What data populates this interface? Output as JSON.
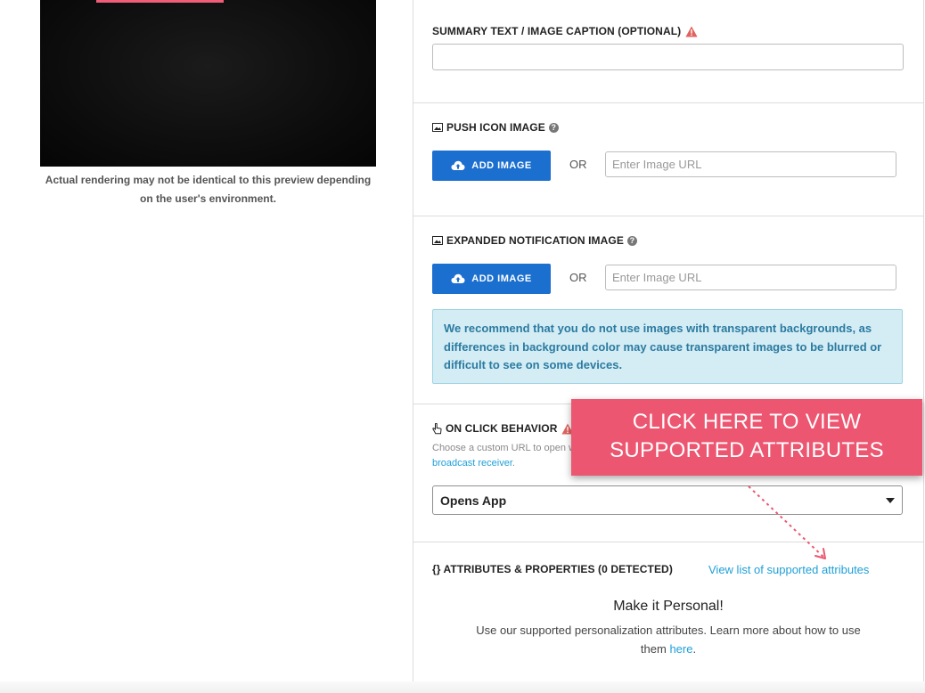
{
  "preview": {
    "note": "Actual rendering may not be identical to this preview depending on the user's environment."
  },
  "summary": {
    "label": "SUMMARY TEXT / IMAGE CAPTION (OPTIONAL)",
    "value": ""
  },
  "push_icon": {
    "label": "PUSH ICON IMAGE",
    "add_button": "ADD IMAGE",
    "or": "OR",
    "url_placeholder": "Enter Image URL"
  },
  "expanded": {
    "label": "EXPANDED NOTIFICATION IMAGE",
    "add_button": "ADD IMAGE",
    "or": "OR",
    "url_placeholder": "Enter Image URL",
    "info": "We recommend that you do not use images with transparent backgrounds, as differences in background color may cause transparent images to be blurred or difficult to see on some devices."
  },
  "on_click": {
    "label": "ON CLICK BEHAVIOR",
    "desc_prefix": "Choose a custom URL to open when the notification is clicked. You may need to",
    "desc_link": "update your app's broadcast receiver",
    "desc_suffix": ".",
    "selected": "Opens App"
  },
  "attributes": {
    "label": "{} ATTRIBUTES & PROPERTIES (0 DETECTED)",
    "link": "View list of supported attributes",
    "title": "Make it Personal!",
    "text_prefix": "Use our supported personalization attributes. Learn more about how to use them",
    "text_link": "here",
    "text_suffix": "."
  },
  "callout": {
    "line1": "CLICK HERE TO VIEW",
    "line2": "SUPPORTED ATTRIBUTES"
  },
  "colors": {
    "primary": "#1b6fcf",
    "callout": "#ec5670",
    "link": "#1fa0d8",
    "info_bg": "#d4edf5"
  },
  "icons": [
    "cloud-upload-icon",
    "image-icon",
    "help-icon",
    "warning-icon",
    "pointer-icon",
    "dropdown-caret-icon"
  ]
}
